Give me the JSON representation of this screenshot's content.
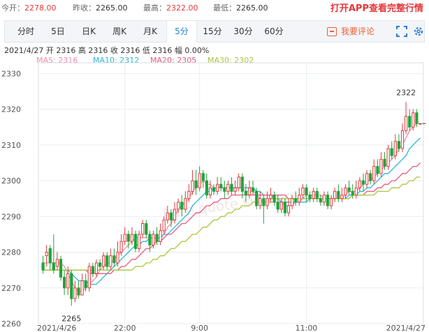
{
  "quote": {
    "open_label": "今开：",
    "open_value": "2278.00",
    "prev_close_label": "昨收：",
    "prev_close_value": "2265.00",
    "high_label": "最高：",
    "high_value": "2322.00",
    "low_label": "最低：",
    "low_value": "2265.00"
  },
  "app_link": "打开APP查看完整行情",
  "tabs": [
    "分时",
    "5日",
    "日K",
    "周K",
    "月K",
    "5分",
    "15分",
    "30分",
    "60分"
  ],
  "active_tab": "5分",
  "comment_button": "我要评论",
  "tools": {
    "fullscreen_icon": "fullscreen-icon",
    "settings_icon": "settings-icon"
  },
  "info_line": "2021/4/27  开 2316  高 2316  收 2316  低 2316  幅 0.00%",
  "ma_legend": [
    {
      "label": "MA5: 2316",
      "color": "#f08ca8"
    },
    {
      "label": "MA10: 2312",
      "color": "#28b7d7"
    },
    {
      "label": "MA20: 2305",
      "color": "#e85a7a"
    },
    {
      "label": "MA30: 2302",
      "color": "#a8c83a"
    }
  ],
  "colors": {
    "up": "#e4393c",
    "down": "#1ea53a",
    "grid": "#e8edf2",
    "axis_text": "#555555"
  },
  "watermark_text": "Aute.quote.sina.org",
  "chart_data": {
    "type": "candlestick",
    "ylim": [
      2260,
      2333
    ],
    "yticks": [
      2260,
      2270,
      2280,
      2290,
      2300,
      2310,
      2320,
      2330
    ],
    "x_tick_labels": [
      {
        "label": "2021/4/26",
        "index": 0
      },
      {
        "label": "22:00",
        "index": 23
      },
      {
        "label": "9:00",
        "index": 44
      },
      {
        "label": "11:00",
        "index": 74
      },
      {
        "label": "2021/4/27",
        "index": 106
      }
    ],
    "annotations": [
      {
        "text": "2322",
        "index": 102,
        "value": 2322,
        "position": "above"
      },
      {
        "text": "2265",
        "index": 8,
        "value": 2265,
        "position": "below"
      }
    ],
    "candles": [
      [
        2277,
        2275,
        2279,
        2274
      ],
      [
        2279,
        2280,
        2282,
        2276
      ],
      [
        2281,
        2277,
        2282,
        2275
      ],
      [
        2277,
        2275,
        2285,
        2274
      ],
      [
        2276,
        2278,
        2280,
        2275
      ],
      [
        2278,
        2273,
        2279,
        2272
      ],
      [
        2273,
        2270,
        2275,
        2268
      ],
      [
        2270,
        2274,
        2276,
        2268
      ],
      [
        2274,
        2267,
        2275,
        2265
      ],
      [
        2267,
        2270,
        2272,
        2266
      ],
      [
        2270,
        2268,
        2272,
        2267
      ],
      [
        2268,
        2272,
        2274,
        2268
      ],
      [
        2272,
        2270,
        2274,
        2269
      ],
      [
        2270,
        2276,
        2277,
        2269
      ],
      [
        2276,
        2274,
        2277,
        2273
      ],
      [
        2274,
        2277,
        2278,
        2273
      ],
      [
        2277,
        2276,
        2278,
        2275
      ],
      [
        2276,
        2279,
        2280,
        2275
      ],
      [
        2279,
        2276,
        2280,
        2275
      ],
      [
        2276,
        2279,
        2281,
        2275
      ],
      [
        2279,
        2277,
        2281,
        2276
      ],
      [
        2277,
        2280,
        2283,
        2276
      ],
      [
        2280,
        2283,
        2285,
        2279
      ],
      [
        2283,
        2285,
        2287,
        2282
      ],
      [
        2285,
        2283,
        2286,
        2281
      ],
      [
        2283,
        2285,
        2287,
        2282
      ],
      [
        2285,
        2281,
        2286,
        2280
      ],
      [
        2281,
        2285,
        2286,
        2280
      ],
      [
        2285,
        2288,
        2289,
        2284
      ],
      [
        2288,
        2285,
        2289,
        2284
      ],
      [
        2285,
        2282,
        2286,
        2280
      ],
      [
        2282,
        2285,
        2286,
        2281
      ],
      [
        2285,
        2283,
        2287,
        2282
      ],
      [
        2283,
        2286,
        2288,
        2282
      ],
      [
        2286,
        2289,
        2290,
        2285
      ],
      [
        2289,
        2291,
        2293,
        2288
      ],
      [
        2291,
        2289,
        2292,
        2287
      ],
      [
        2289,
        2292,
        2294,
        2288
      ],
      [
        2292,
        2294,
        2295,
        2291
      ],
      [
        2294,
        2292,
        2296,
        2290
      ],
      [
        2292,
        2295,
        2297,
        2291
      ],
      [
        2295,
        2297,
        2299,
        2294
      ],
      [
        2297,
        2300,
        2303,
        2296
      ],
      [
        2300,
        2298,
        2303,
        2296
      ],
      [
        2298,
        2302,
        2304,
        2297
      ],
      [
        2302,
        2300,
        2303,
        2298
      ],
      [
        2300,
        2296,
        2302,
        2295
      ],
      [
        2296,
        2298,
        2300,
        2295
      ],
      [
        2298,
        2297,
        2299,
        2296
      ],
      [
        2297,
        2299,
        2301,
        2296
      ],
      [
        2299,
        2298,
        2301,
        2297
      ],
      [
        2298,
        2297,
        2300,
        2295
      ],
      [
        2297,
        2299,
        2300,
        2296
      ],
      [
        2299,
        2297,
        2301,
        2296
      ],
      [
        2297,
        2298,
        2300,
        2296
      ],
      [
        2298,
        2301,
        2302,
        2297
      ],
      [
        2301,
        2297,
        2302,
        2295
      ],
      [
        2297,
        2296,
        2299,
        2294
      ],
      [
        2296,
        2298,
        2300,
        2295
      ],
      [
        2298,
        2297,
        2300,
        2296
      ],
      [
        2297,
        2293,
        2298,
        2292
      ],
      [
        2293,
        2295,
        2297,
        2292
      ],
      [
        2295,
        2293,
        2296,
        2288
      ],
      [
        2293,
        2295,
        2297,
        2292
      ],
      [
        2295,
        2296,
        2298,
        2294
      ],
      [
        2296,
        2294,
        2297,
        2293
      ],
      [
        2294,
        2292,
        2296,
        2291
      ],
      [
        2292,
        2294,
        2295,
        2291
      ],
      [
        2294,
        2291,
        2295,
        2290
      ],
      [
        2291,
        2293,
        2295,
        2290
      ],
      [
        2293,
        2295,
        2296,
        2292
      ],
      [
        2295,
        2294,
        2297,
        2293
      ],
      [
        2294,
        2296,
        2298,
        2293
      ],
      [
        2296,
        2298,
        2299,
        2295
      ],
      [
        2298,
        2296,
        2299,
        2294
      ],
      [
        2296,
        2295,
        2297,
        2294
      ],
      [
        2295,
        2297,
        2298,
        2294
      ],
      [
        2297,
        2295,
        2298,
        2294
      ],
      [
        2295,
        2294,
        2296,
        2293
      ],
      [
        2294,
        2296,
        2297,
        2293
      ],
      [
        2296,
        2293,
        2297,
        2292
      ],
      [
        2293,
        2295,
        2296,
        2292
      ],
      [
        2295,
        2297,
        2298,
        2294
      ],
      [
        2297,
        2295,
        2299,
        2294
      ],
      [
        2295,
        2296,
        2298,
        2294
      ],
      [
        2296,
        2298,
        2299,
        2295
      ],
      [
        2298,
        2297,
        2300,
        2296
      ],
      [
        2297,
        2296,
        2299,
        2295
      ],
      [
        2296,
        2298,
        2300,
        2295
      ],
      [
        2298,
        2300,
        2301,
        2297
      ],
      [
        2300,
        2299,
        2302,
        2297
      ],
      [
        2299,
        2302,
        2303,
        2298
      ],
      [
        2302,
        2300,
        2303,
        2299
      ],
      [
        2300,
        2304,
        2306,
        2299
      ],
      [
        2304,
        2302,
        2306,
        2301
      ],
      [
        2302,
        2306,
        2308,
        2301
      ],
      [
        2306,
        2304,
        2308,
        2303
      ],
      [
        2304,
        2309,
        2310,
        2303
      ],
      [
        2309,
        2307,
        2311,
        2306
      ],
      [
        2307,
        2311,
        2313,
        2306
      ],
      [
        2311,
        2309,
        2313,
        2308
      ],
      [
        2309,
        2314,
        2316,
        2308
      ],
      [
        2314,
        2318,
        2322,
        2313
      ],
      [
        2318,
        2315,
        2320,
        2314
      ],
      [
        2315,
        2319,
        2320,
        2314
      ],
      [
        2319,
        2316,
        2320,
        2315
      ],
      [
        2316,
        2316,
        2316,
        2316
      ]
    ],
    "series": [
      {
        "name": "MA5",
        "values": [
          2277,
          2277,
          2277,
          2277,
          2277,
          2277,
          2276,
          2274,
          2272,
          2270,
          2269,
          2269,
          2270,
          2271,
          2272,
          2273,
          2275,
          2276,
          2277,
          2277,
          2278,
          2279,
          2280,
          2281,
          2282,
          2283,
          2284,
          2284,
          2284,
          2284,
          2284,
          2284,
          2284,
          2284,
          2285,
          2287,
          2288,
          2290,
          2292,
          2293,
          2294,
          2295,
          2297,
          2298,
          2299,
          2300,
          2299,
          2299,
          2298,
          2298,
          2298,
          2298,
          2298,
          2298,
          2298,
          2298,
          2298,
          2297,
          2297,
          2297,
          2296,
          2295,
          2294,
          2294,
          2294,
          2294,
          2294,
          2294,
          2293,
          2293,
          2293,
          2294,
          2294,
          2295,
          2296,
          2296,
          2296,
          2296,
          2296,
          2295,
          2295,
          2295,
          2295,
          2295,
          2295,
          2296,
          2297,
          2297,
          2297,
          2298,
          2299,
          2300,
          2300,
          2301,
          2302,
          2303,
          2304,
          2305,
          2306,
          2307,
          2309,
          2310,
          2312,
          2314,
          2315,
          2316,
          2316
        ]
      },
      {
        "name": "MA10",
        "values": [
          2275,
          2275,
          2275,
          2275,
          2275,
          2275,
          2275,
          2275,
          2274,
          2273,
          2272,
          2272,
          2272,
          2271,
          2271,
          2271,
          2272,
          2273,
          2274,
          2275,
          2276,
          2277,
          2278,
          2279,
          2280,
          2281,
          2282,
          2282,
          2283,
          2283,
          2284,
          2284,
          2284,
          2284,
          2285,
          2285,
          2286,
          2287,
          2288,
          2289,
          2290,
          2291,
          2293,
          2294,
          2295,
          2296,
          2297,
          2297,
          2298,
          2298,
          2298,
          2298,
          2298,
          2298,
          2298,
          2298,
          2298,
          2298,
          2298,
          2298,
          2297,
          2297,
          2296,
          2296,
          2296,
          2295,
          2295,
          2294,
          2294,
          2294,
          2294,
          2294,
          2294,
          2294,
          2294,
          2295,
          2295,
          2295,
          2295,
          2295,
          2295,
          2295,
          2295,
          2295,
          2295,
          2295,
          2296,
          2296,
          2296,
          2297,
          2297,
          2298,
          2298,
          2299,
          2300,
          2301,
          2302,
          2302,
          2303,
          2304,
          2305,
          2306,
          2307,
          2309,
          2310,
          2311,
          2312
        ]
      },
      {
        "name": "MA20",
        "values": [
          2275,
          2275,
          2275,
          2275,
          2275,
          2275,
          2275,
          2275,
          2275,
          2275,
          2275,
          2275,
          2275,
          2274,
          2274,
          2274,
          2274,
          2274,
          2274,
          2274,
          2275,
          2275,
          2276,
          2276,
          2277,
          2278,
          2278,
          2279,
          2280,
          2281,
          2281,
          2282,
          2283,
          2283,
          2284,
          2285,
          2285,
          2286,
          2287,
          2288,
          2288,
          2289,
          2290,
          2291,
          2291,
          2292,
          2293,
          2293,
          2294,
          2294,
          2295,
          2295,
          2295,
          2296,
          2296,
          2296,
          2296,
          2296,
          2296,
          2296,
          2296,
          2296,
          2296,
          2296,
          2296,
          2296,
          2296,
          2296,
          2296,
          2295,
          2295,
          2295,
          2295,
          2295,
          2295,
          2295,
          2295,
          2295,
          2295,
          2295,
          2295,
          2295,
          2295,
          2295,
          2295,
          2295,
          2295,
          2296,
          2296,
          2296,
          2296,
          2297,
          2297,
          2297,
          2298,
          2298,
          2299,
          2299,
          2300,
          2300,
          2301,
          2302,
          2302,
          2303,
          2304,
          2304,
          2305
        ]
      },
      {
        "name": "MA30",
        "values": [
          2275,
          2275,
          2275,
          2275,
          2275,
          2275,
          2275,
          2275,
          2275,
          2275,
          2275,
          2275,
          2275,
          2275,
          2275,
          2275,
          2275,
          2275,
          2275,
          2275,
          2275,
          2275,
          2275,
          2275,
          2275,
          2275,
          2276,
          2276,
          2276,
          2277,
          2277,
          2278,
          2278,
          2279,
          2279,
          2280,
          2281,
          2281,
          2282,
          2283,
          2283,
          2284,
          2285,
          2285,
          2286,
          2287,
          2287,
          2288,
          2289,
          2289,
          2290,
          2290,
          2291,
          2291,
          2292,
          2292,
          2293,
          2293,
          2293,
          2294,
          2294,
          2294,
          2294,
          2294,
          2295,
          2295,
          2295,
          2295,
          2295,
          2295,
          2295,
          2295,
          2295,
          2295,
          2295,
          2295,
          2295,
          2295,
          2295,
          2295,
          2295,
          2295,
          2295,
          2295,
          2295,
          2295,
          2295,
          2296,
          2296,
          2296,
          2296,
          2296,
          2296,
          2296,
          2297,
          2297,
          2297,
          2297,
          2298,
          2298,
          2298,
          2299,
          2299,
          2300,
          2300,
          2301,
          2301
        ]
      }
    ]
  }
}
